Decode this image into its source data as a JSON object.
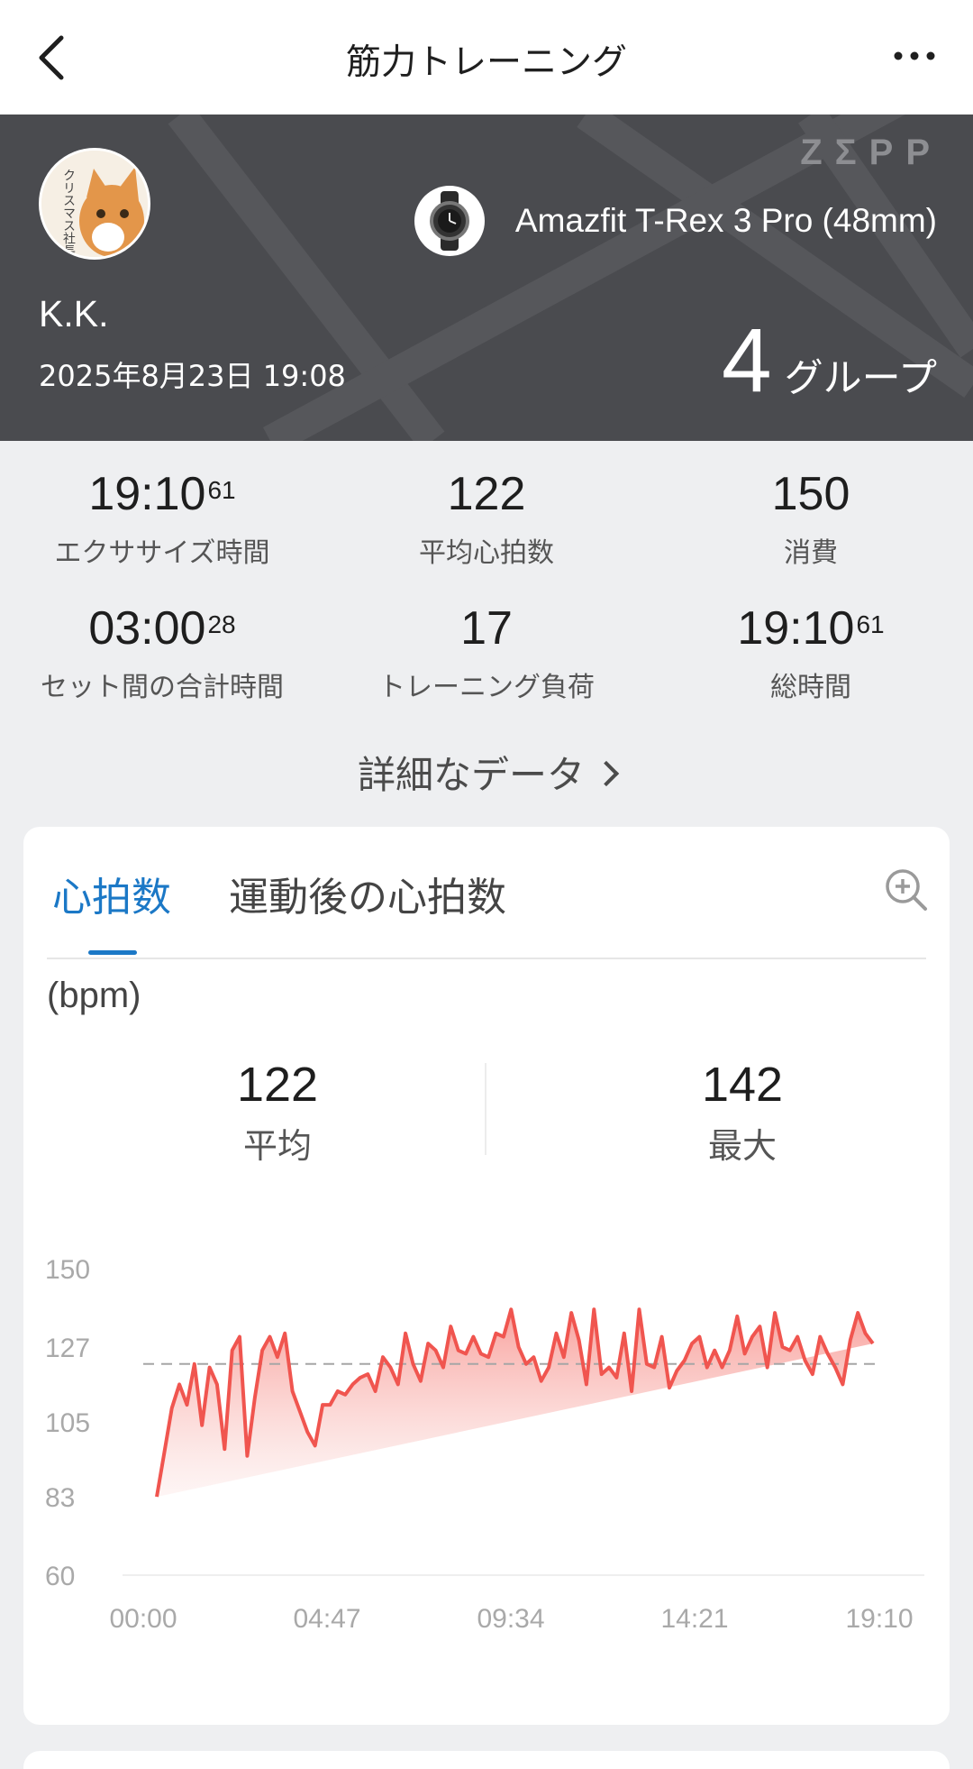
{
  "header": {
    "title": "筋力トレーニング"
  },
  "summary": {
    "brand": "ZΣPP",
    "device_name": "Amazfit T-Rex 3 Pro (48mm)",
    "user_name": "K.K.",
    "date": "2025年8月23日 19:08",
    "group_value": "4",
    "group_unit": "グループ",
    "avatar_text": "クリスマス社長"
  },
  "stats": [
    {
      "main": "19:10",
      "sup": "61",
      "label": "エクササイズ時間"
    },
    {
      "main": "122",
      "sup": "",
      "label": "平均心拍数"
    },
    {
      "main": "150",
      "sup": "",
      "label": "消費"
    },
    {
      "main": "03:00",
      "sup": "28",
      "label": "セット間の合計時間"
    },
    {
      "main": "17",
      "sup": "",
      "label": "トレーニング負荷"
    },
    {
      "main": "19:10",
      "sup": "61",
      "label": "総時間"
    }
  ],
  "details_link": "詳細なデータ",
  "heart_card": {
    "tabs": [
      "心拍数",
      "運動後の心拍数"
    ],
    "unit": "(bpm)",
    "avg_value": "122",
    "avg_label": "平均",
    "max_value": "142",
    "max_label": "最大"
  },
  "colors": {
    "accent": "#1b78c6",
    "line": "#f0554f",
    "header_bg": "#4a4b4f"
  },
  "chart_data": {
    "type": "area",
    "ylim": [
      60,
      150
    ],
    "yticks": [
      "150",
      "127",
      "105",
      "83",
      "60"
    ],
    "xticks": [
      "00:00",
      "04:47",
      "09:34",
      "14:21",
      "19:10"
    ],
    "reference_line": 122,
    "x_minutes": [
      0,
      0.2,
      0.4,
      0.6,
      0.8,
      1,
      1.2,
      1.4,
      1.6,
      1.8,
      2,
      2.2,
      2.4,
      2.6,
      2.8,
      3,
      3.2,
      3.4,
      3.6,
      3.8,
      4,
      4.2,
      4.4,
      4.6,
      4.8,
      5,
      5.2,
      5.4,
      5.6,
      5.8,
      6,
      6.2,
      6.4,
      6.6,
      6.8,
      7,
      7.2,
      7.4,
      7.6,
      7.8,
      8,
      8.2,
      8.4,
      8.6,
      8.8,
      9,
      9.2,
      9.4,
      9.6,
      9.8,
      10,
      10.2,
      10.4,
      10.6,
      10.8,
      11,
      11.2,
      11.4,
      11.6,
      11.8,
      12,
      12.2,
      12.4,
      12.6,
      12.8,
      13,
      13.2,
      13.4,
      13.6,
      13.8,
      14,
      14.2,
      14.4,
      14.6,
      14.8,
      15,
      15.2,
      15.4,
      15.6,
      15.8,
      16,
      16.2,
      16.4,
      16.6,
      16.8,
      17,
      17.2,
      17.4,
      17.6,
      17.8,
      18,
      18.2,
      18.4,
      18.6,
      18.8,
      19,
      19.17
    ],
    "values": [
      83,
      96,
      109,
      116,
      110,
      122,
      104,
      121,
      116,
      97,
      126,
      130,
      95,
      112,
      126,
      130,
      124,
      131,
      114,
      108,
      102,
      98,
      110,
      110,
      114,
      113,
      116,
      118,
      119,
      114,
      124,
      121,
      116,
      131,
      122,
      117,
      128,
      126,
      121,
      133,
      126,
      125,
      130,
      125,
      124,
      131,
      130,
      138,
      127,
      122,
      124,
      117,
      121,
      131,
      124,
      137,
      129,
      116,
      138,
      119,
      121,
      118,
      131,
      114,
      138,
      122,
      121,
      130,
      115,
      120,
      123,
      128,
      130,
      121,
      126,
      121,
      126,
      136,
      125,
      130,
      133,
      121,
      137,
      127,
      126,
      130,
      123,
      119,
      130,
      125,
      121,
      116,
      129,
      137,
      131,
      128
    ]
  }
}
